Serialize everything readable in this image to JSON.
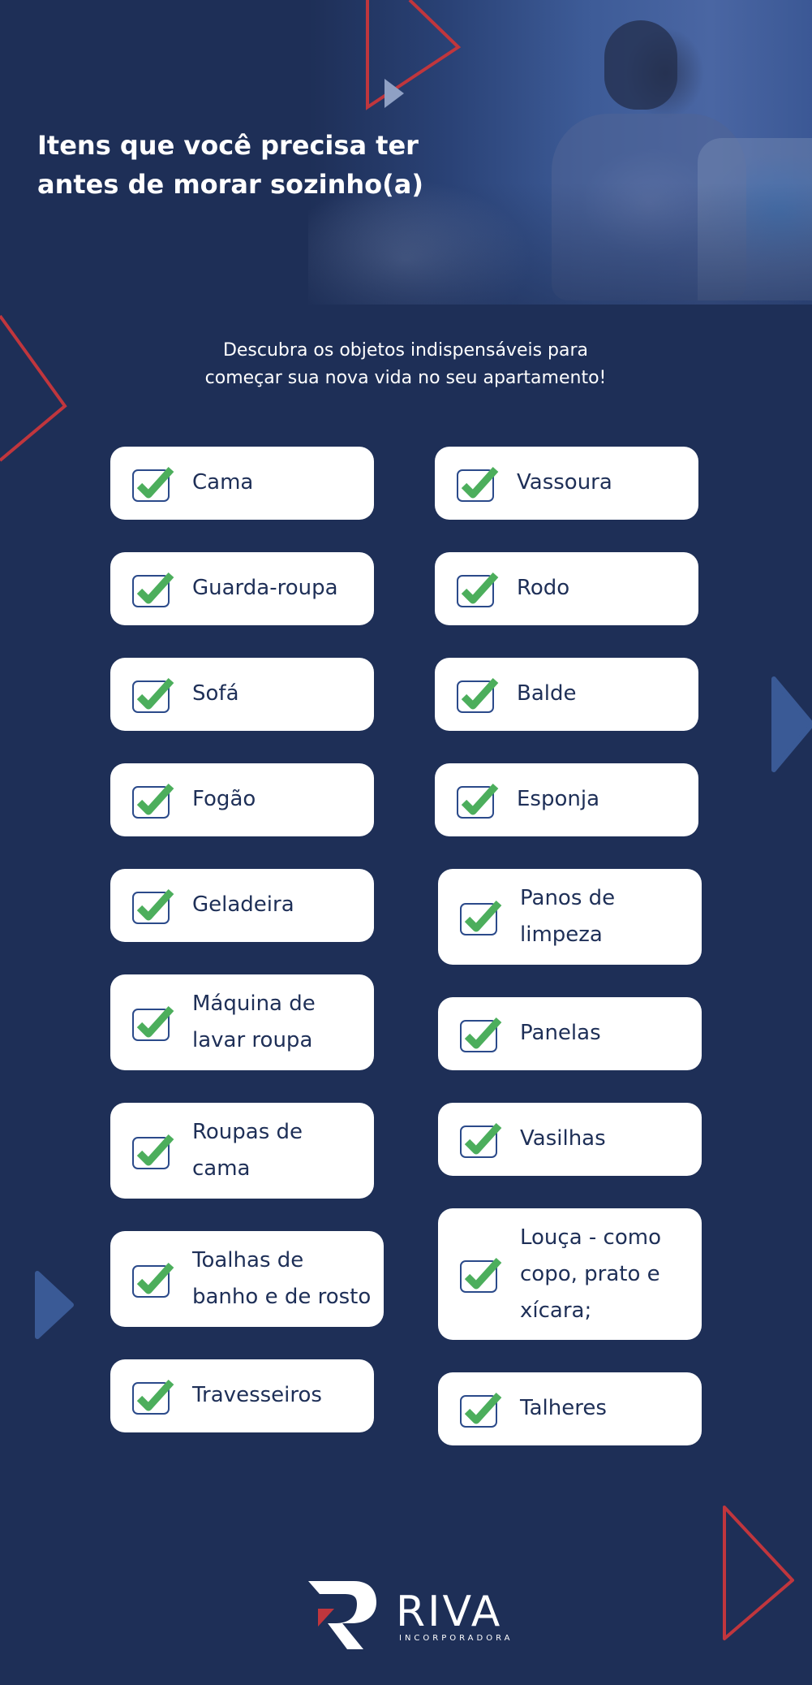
{
  "hero": {
    "title_line1": "Itens que você precisa ter",
    "title_line2": "antes de morar sozinho(a)"
  },
  "intro": {
    "line1": "Descubra os objetos indispensáveis para",
    "line2": "começar sua nova vida no seu apartamento!"
  },
  "left_items": [
    {
      "label": "Cama",
      "checked": true
    },
    {
      "label": "Guarda-roupa",
      "checked": true
    },
    {
      "label": "Sofá",
      "checked": true
    },
    {
      "label": "Fogão",
      "checked": true
    },
    {
      "label": "Geladeira",
      "checked": true
    },
    {
      "label": "Máquina de\nlavar roupa",
      "checked": true
    },
    {
      "label": "Roupas de\ncama",
      "checked": true
    },
    {
      "label": "Toalhas de\nbanho e de rosto",
      "checked": true
    },
    {
      "label": "Travesseiros",
      "checked": true
    }
  ],
  "right_items": [
    {
      "label": "Vassoura",
      "checked": true
    },
    {
      "label": "Rodo",
      "checked": true
    },
    {
      "label": "Balde",
      "checked": true
    },
    {
      "label": "Esponja",
      "checked": true
    },
    {
      "label": "Panos de\nlimpeza",
      "checked": true
    },
    {
      "label": "Panelas",
      "checked": true
    },
    {
      "label": "Vasilhas",
      "checked": true
    },
    {
      "label": "Louça - como\ncopo, prato e\nxícara;",
      "checked": true
    },
    {
      "label": "Talheres",
      "checked": true
    }
  ],
  "logo": {
    "wordmark": "RIVA",
    "tagline": "INCORPORADORA"
  },
  "colors": {
    "background": "#1e2f57",
    "card": "#ffffff",
    "check_green": "#4cae5c",
    "check_box": "#2b4a8a",
    "accent_red": "#c0363d",
    "accent_blue": "#3a5a96"
  }
}
